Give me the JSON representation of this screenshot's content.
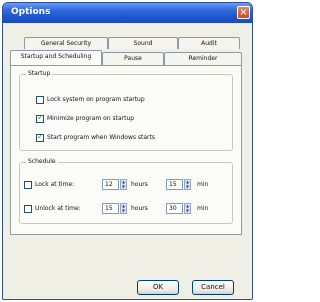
{
  "window": {
    "title": "Options"
  },
  "tabs": {
    "row1": [
      "General Security",
      "Sound",
      "Audit"
    ],
    "row2": [
      "Startup and Scheduling",
      "Pause",
      "Reminder"
    ]
  },
  "startup": {
    "legend": "Startup",
    "items": [
      {
        "label": "Lock system on program startup",
        "checked": false
      },
      {
        "label": "Minimize program on startup",
        "checked": true
      },
      {
        "label": "Start program when Windows starts",
        "checked": true
      }
    ]
  },
  "schedule": {
    "legend": "Schedule",
    "lock": {
      "label": "Lock at time:",
      "checked": false,
      "hours": "12",
      "hours_unit": "hours",
      "mins": "15",
      "mins_unit": "min"
    },
    "unlock": {
      "label": "Unlock at time:",
      "checked": false,
      "hours": "15",
      "hours_unit": "hours",
      "mins": "30",
      "mins_unit": "min"
    }
  },
  "buttons": {
    "ok": "OK",
    "cancel": "Cancel"
  },
  "icons": {
    "close": "close-icon",
    "spin_up": "arrow-up-icon",
    "spin_down": "arrow-down-icon",
    "check": "checkmark-icon"
  }
}
